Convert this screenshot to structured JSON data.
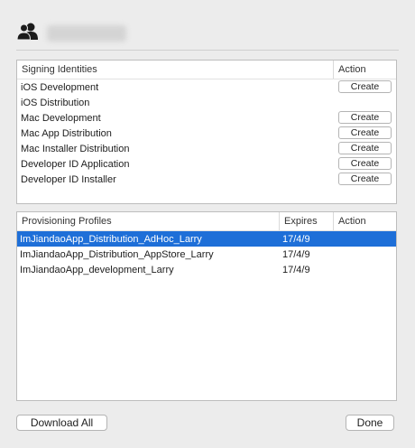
{
  "header": {
    "team_icon": "person-group-icon"
  },
  "signing_identities": {
    "column_header": "Signing Identities",
    "action_header": "Action",
    "rows": [
      {
        "label": "iOS Development",
        "action": "Create"
      },
      {
        "label": "iOS Distribution",
        "action": ""
      },
      {
        "label": "Mac Development",
        "action": "Create"
      },
      {
        "label": "Mac App Distribution",
        "action": "Create"
      },
      {
        "label": "Mac Installer Distribution",
        "action": "Create"
      },
      {
        "label": "Developer ID Application",
        "action": "Create"
      },
      {
        "label": "Developer ID Installer",
        "action": "Create"
      }
    ]
  },
  "provisioning_profiles": {
    "column_header": "Provisioning Profiles",
    "expires_header": "Expires",
    "action_header": "Action",
    "rows": [
      {
        "name": "ImJiandaoApp_Distribution_AdHoc_Larry",
        "expires": "17/4/9",
        "selected": true
      },
      {
        "name": "ImJiandaoApp_Distribution_AppStore_Larry",
        "expires": "17/4/9",
        "selected": false
      },
      {
        "name": "ImJiandaoApp_development_Larry",
        "expires": "17/4/9",
        "selected": false
      }
    ]
  },
  "buttons": {
    "download_all": "Download All",
    "done": "Done"
  },
  "colors": {
    "selection": "#1e6fd8",
    "window_bg": "#ececec"
  }
}
